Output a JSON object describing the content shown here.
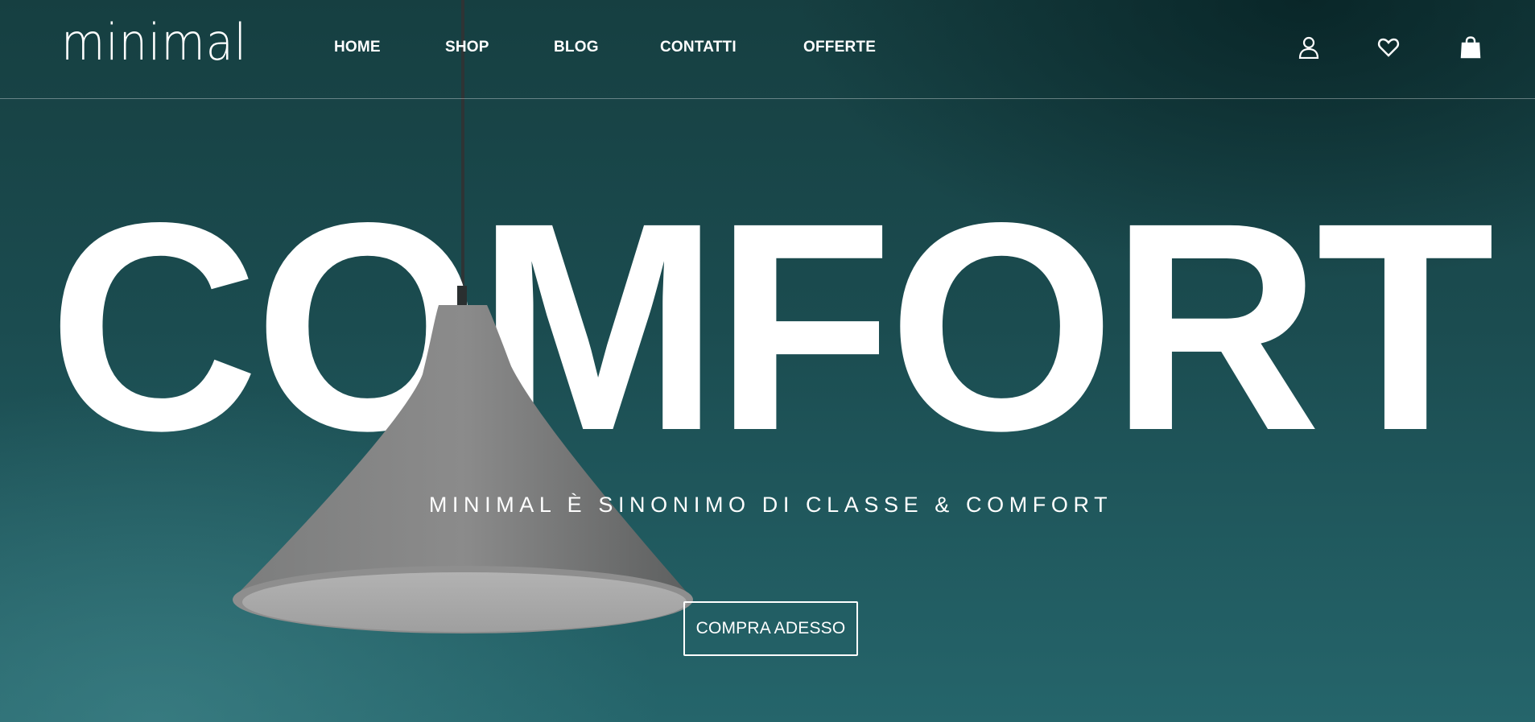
{
  "header": {
    "logo": "minimal",
    "nav": [
      {
        "label": "HOME"
      },
      {
        "label": "SHOP"
      },
      {
        "label": "BLOG"
      },
      {
        "label": "CONTATTI"
      },
      {
        "label": "OFFERTE"
      }
    ],
    "icons": [
      "user-icon",
      "heart-icon",
      "shopping-bag-icon"
    ]
  },
  "hero": {
    "title": "COMFORT",
    "subtitle": "MINIMAL È SINONIMO DI CLASSE & COMFORT",
    "cta_label": "COMPRA ADESSO"
  },
  "colors": {
    "background": "#1b4a4f",
    "text": "#ffffff",
    "lamp": "#8a8a8a"
  }
}
